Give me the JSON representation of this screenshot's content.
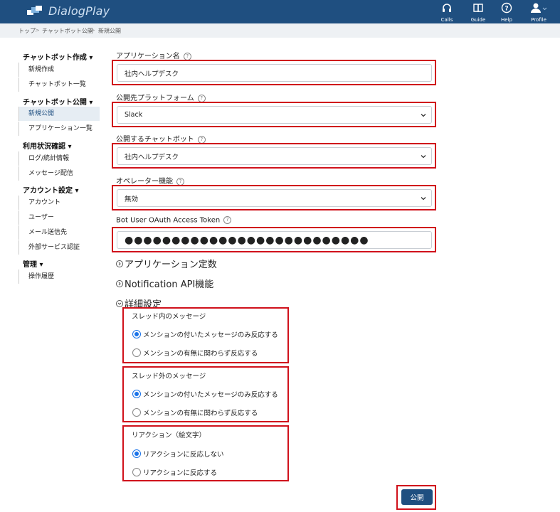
{
  "app": {
    "name": "DialogPlay"
  },
  "nav": [
    {
      "label": "Calls",
      "icon": "headset-icon"
    },
    {
      "label": "Guide",
      "icon": "book-icon"
    },
    {
      "label": "Help",
      "icon": "help-icon"
    },
    {
      "label": "Profile",
      "icon": "user-icon"
    }
  ],
  "breadcrumb": [
    "トップ",
    "チャットボット公開",
    "新規公開"
  ],
  "sidebar": {
    "groups": [
      {
        "title": "チャットボット作成",
        "items": [
          "新規作成",
          "チャットボット一覧"
        ]
      },
      {
        "title": "チャットボット公開",
        "items": [
          "新規公開",
          "アプリケーション一覧"
        ]
      },
      {
        "title": "利用状況確認",
        "items": [
          "ログ/統計情報",
          "メッセージ配信"
        ]
      },
      {
        "title": "アカウント設定",
        "items": [
          "アカウント",
          "ユーザー",
          "メール送信先",
          "外部サービス認証"
        ]
      },
      {
        "title": "管理",
        "items": [
          "操作履歴"
        ]
      }
    ],
    "active": "新規公開"
  },
  "form": {
    "app_name": {
      "label": "アプリケーション名",
      "value": "社内ヘルプデスク"
    },
    "platform": {
      "label": "公開先プラットフォーム",
      "value": "Slack"
    },
    "chatbot": {
      "label": "公開するチャットボット",
      "value": "社内ヘルプデスク"
    },
    "operator": {
      "label": "オペレーター機能",
      "value": "無効"
    },
    "token": {
      "label": "Bot User OAuth Access Token",
      "value": "●●●●●●●●●●●●●●●●●●●●●●●●●●"
    }
  },
  "sections": {
    "app_constants": "アプリケーション定数",
    "notification_api": "Notification API機能",
    "advanced": "詳細設定"
  },
  "advanced": {
    "in_thread": {
      "title": "スレッド内のメッセージ",
      "options": [
        "メンションの付いたメッセージのみ反応する",
        "メンションの有無に関わらず反応する"
      ],
      "selected": 0
    },
    "out_thread": {
      "title": "スレッド外のメッセージ",
      "options": [
        "メンションの付いたメッセージのみ反応する",
        "メンションの有無に関わらず反応する"
      ],
      "selected": 0
    },
    "reaction": {
      "title": "リアクション（絵文字）",
      "options": [
        "リアクションに反応しない",
        "リアクションに反応する"
      ],
      "selected": 0
    }
  },
  "publish_label": "公開",
  "colors": {
    "header": "#1f4f80",
    "highlight": "#d0111b",
    "radio": "#1a73e8"
  }
}
